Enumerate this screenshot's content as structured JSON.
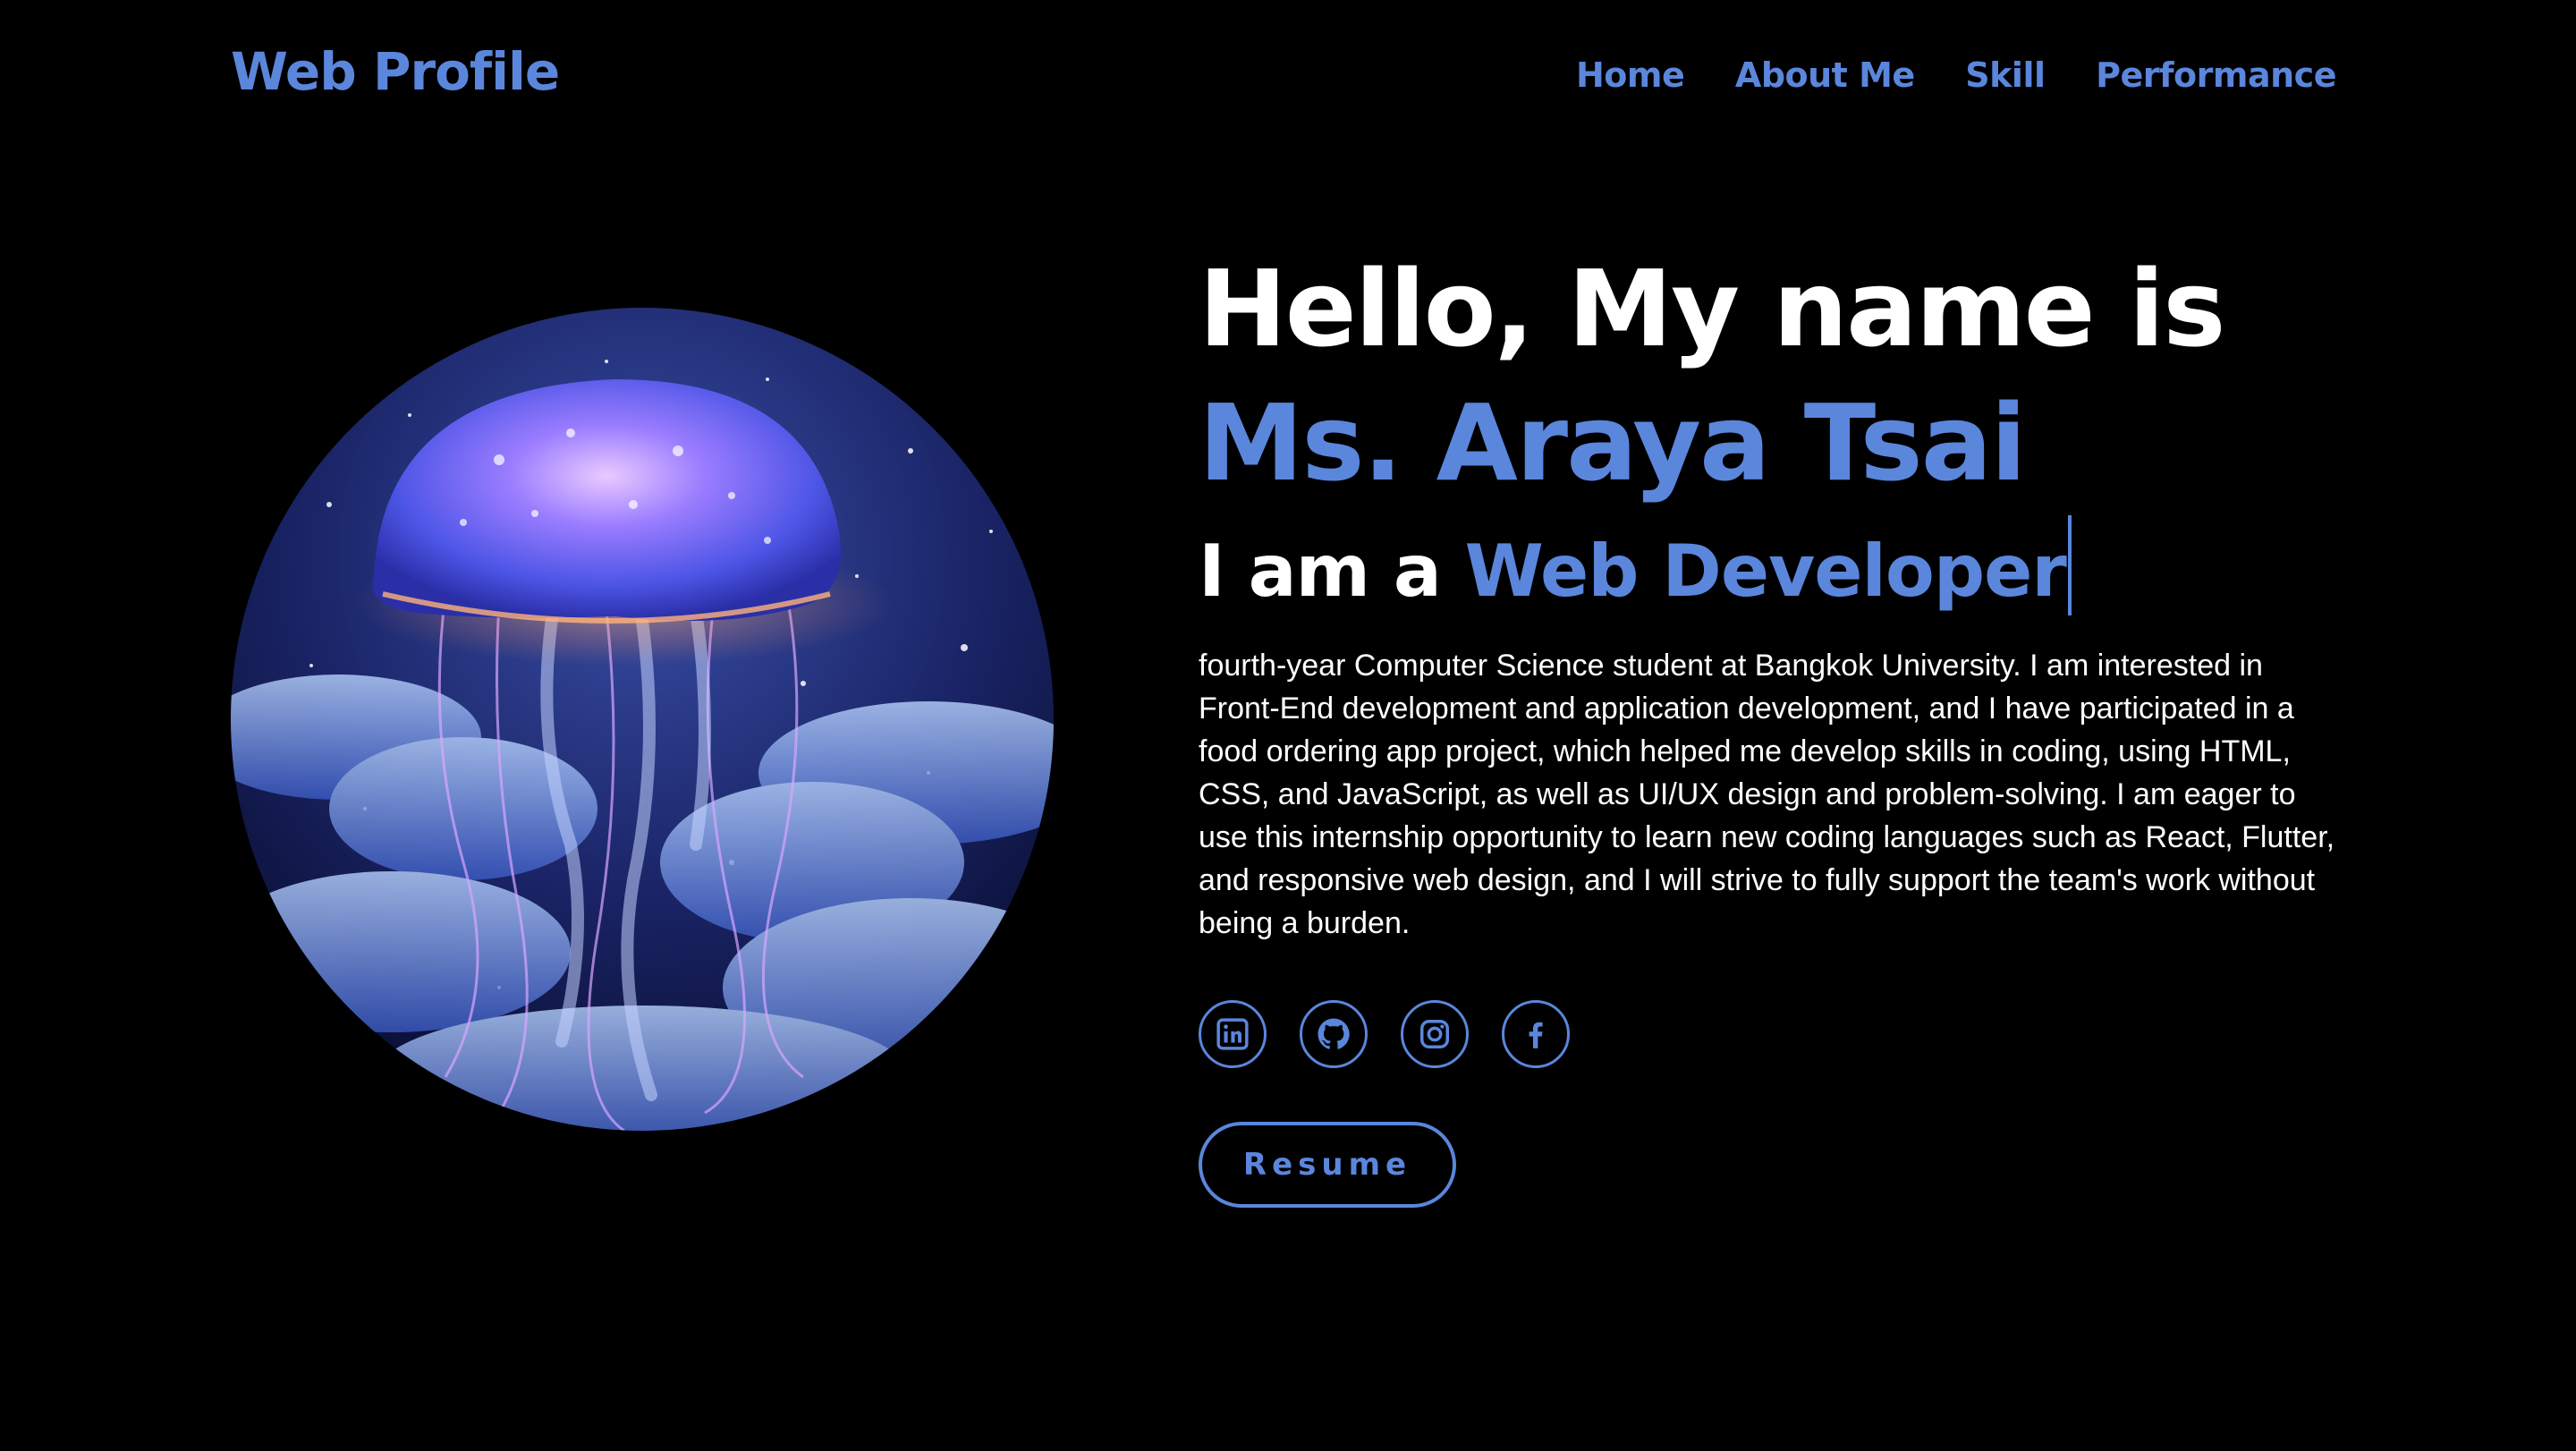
{
  "header": {
    "logo": "Web Profile",
    "nav": [
      {
        "label": "Home"
      },
      {
        "label": "About Me"
      },
      {
        "label": "Skill"
      },
      {
        "label": "Performance"
      }
    ]
  },
  "hero": {
    "greeting": "Hello, My name is",
    "name": "Ms. Araya Tsai",
    "role_prefix": "I am a",
    "role": "Web Developer",
    "bio": "fourth-year Computer Science student at Bangkok University. I am interested in Front-End development and application development, and I have participated in a food ordering app project, which helped me develop skills in coding, using HTML, CSS, and JavaScript, as well as UI/UX design and problem-solving. I am eager to use this internship opportunity to learn new coding languages such as React, Flutter, and responsive web design, and I will strive to fully support the team's work without being a burden.",
    "socials": [
      {
        "icon": "linkedin-icon"
      },
      {
        "icon": "github-icon"
      },
      {
        "icon": "instagram-icon"
      },
      {
        "icon": "facebook-icon"
      }
    ],
    "resume_label": "Resume",
    "portrait_icon": "jellyfish-illustration"
  },
  "colors": {
    "accent": "#5a86dc",
    "background": "#000000",
    "text": "#ffffff"
  }
}
